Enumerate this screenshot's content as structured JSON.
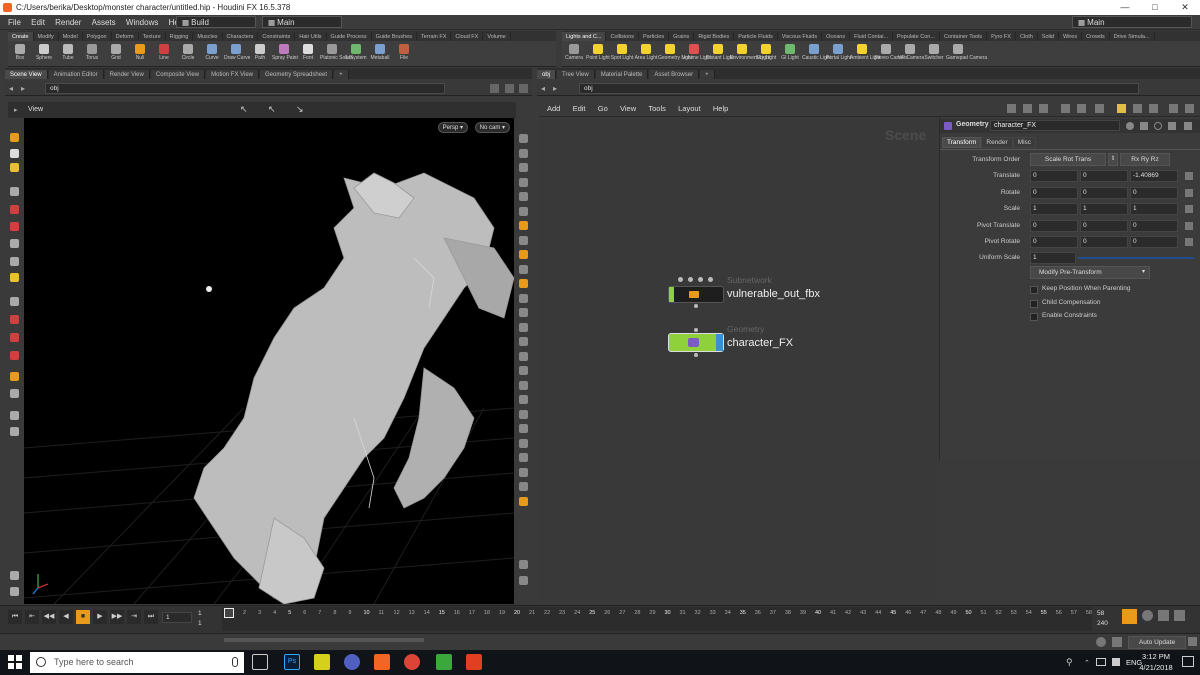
{
  "window": {
    "title": "C:/Users/berika/Desktop/monster character/untitled.hip - Houdini FX 16.5.378",
    "min": "—",
    "max": "□",
    "close": "✕"
  },
  "menu": {
    "items": [
      "File",
      "Edit",
      "Render",
      "Assets",
      "Windows",
      "Help"
    ],
    "desktop": "Build",
    "workspace": "Main",
    "right_workspace": "Main"
  },
  "shelf_left": {
    "tabs": [
      "Create",
      "Modify",
      "Model",
      "Polygon",
      "Deform",
      "Texture",
      "Rigging",
      "Muscles",
      "Characters",
      "Constraints",
      "Hair Utils",
      "Guide Process",
      "Guide Brushes",
      "Terrain FX",
      "Cloud FX",
      "Volume"
    ],
    "tools": [
      "Box",
      "Sphere",
      "Tube",
      "Torus",
      "Grid",
      "Null",
      "Line",
      "Circle",
      "Curve",
      "Draw Curve",
      "Path",
      "Spray Paint",
      "Font",
      "Platonic Solids",
      "L-System",
      "Metaball",
      "File"
    ]
  },
  "shelf_right": {
    "tabs": [
      "Lights and C...",
      "Collisions",
      "Particles",
      "Grains",
      "Rigid Bodies",
      "Particle Fluids",
      "Viscous Fluids",
      "Oceans",
      "Fluid Contai...",
      "Populate Con...",
      "Container Tools",
      "Pyro FX",
      "Cloth",
      "Solid",
      "Wires",
      "Crowds",
      "Drive Simula..."
    ],
    "tools": [
      "Camera",
      "Point Light",
      "Spot Light",
      "Area Light",
      "Geometry Light",
      "Volume Light",
      "Distant Light",
      "Environment Light",
      "Sky Light",
      "GI Light",
      "Caustic Light",
      "Portal Light",
      "Ambient Light",
      "Stereo Camera",
      "VR Camera",
      "Switcher",
      "Gamepad Camera"
    ]
  },
  "left_pane": {
    "tabs": [
      "Scene View",
      "Animation Editor",
      "Render View",
      "Composite View",
      "Motion FX View",
      "Geometry Spreadsheet"
    ],
    "path": "obj",
    "view_label": "View",
    "persp": "Persp ▾",
    "cam": "No cam ▾"
  },
  "right_pane": {
    "tabs": [
      "obj",
      "Tree View",
      "Material Palette",
      "Asset Browser"
    ],
    "path": "obj",
    "menu": [
      "Add",
      "Edit",
      "Go",
      "View",
      "Tools",
      "Layout",
      "Help"
    ],
    "watermark": "Scene"
  },
  "nodes": [
    {
      "type": "Subnetwork",
      "name": "vulnerable_out_fbx"
    },
    {
      "type": "Geometry",
      "name": "character_FX"
    }
  ],
  "params": {
    "node_type": "Geometry",
    "node_name": "character_FX",
    "tabs": [
      "Transform",
      "Render",
      "Misc"
    ],
    "transform_order_label": "Transform Order",
    "transform_order": "Scale Rot Trans",
    "rot_order": "Rx Ry Rz",
    "rows": [
      {
        "label": "Translate",
        "v": [
          "0",
          "0",
          "-1.40869"
        ]
      },
      {
        "label": "Rotate",
        "v": [
          "0",
          "0",
          "0"
        ]
      },
      {
        "label": "Scale",
        "v": [
          "1",
          "1",
          "1"
        ]
      },
      {
        "label": "Pivot Translate",
        "v": [
          "0",
          "0",
          "0"
        ]
      },
      {
        "label": "Pivot Rotate",
        "v": [
          "0",
          "0",
          "0"
        ]
      }
    ],
    "uniform_scale_label": "Uniform Scale",
    "uniform_scale": "1",
    "modify_button": "Modify Pre-Transform",
    "checks": [
      "Keep Position When Parenting",
      "Child Compensation",
      "Enable Constraints"
    ]
  },
  "timeline": {
    "current_frame": "1",
    "start": "1",
    "start2": "1",
    "ticks": [
      "1",
      "2",
      "3",
      "4",
      "5",
      "6",
      "7",
      "8",
      "9",
      "10",
      "11",
      "12",
      "13",
      "14",
      "15",
      "16",
      "17",
      "18",
      "19",
      "20",
      "21",
      "22",
      "23",
      "24",
      "25",
      "26",
      "27",
      "28",
      "29",
      "30",
      "31",
      "32",
      "33",
      "34",
      "35",
      "36",
      "37",
      "38",
      "39",
      "40",
      "41",
      "42",
      "43",
      "44",
      "45",
      "46",
      "47",
      "48",
      "49",
      "50",
      "51",
      "52",
      "53",
      "54",
      "55",
      "56",
      "57",
      "58"
    ],
    "end": "58",
    "end2": "240",
    "auto_update": "Auto Update"
  },
  "taskbar": {
    "search_placeholder": "Type here to search",
    "lang": "ENG",
    "time": "3:12 PM",
    "date": "4/21/2018"
  },
  "colors": {
    "accent_orange": "#e89a1a",
    "node_green": "#8fd13a",
    "node_blue": "#3a8fd1"
  }
}
